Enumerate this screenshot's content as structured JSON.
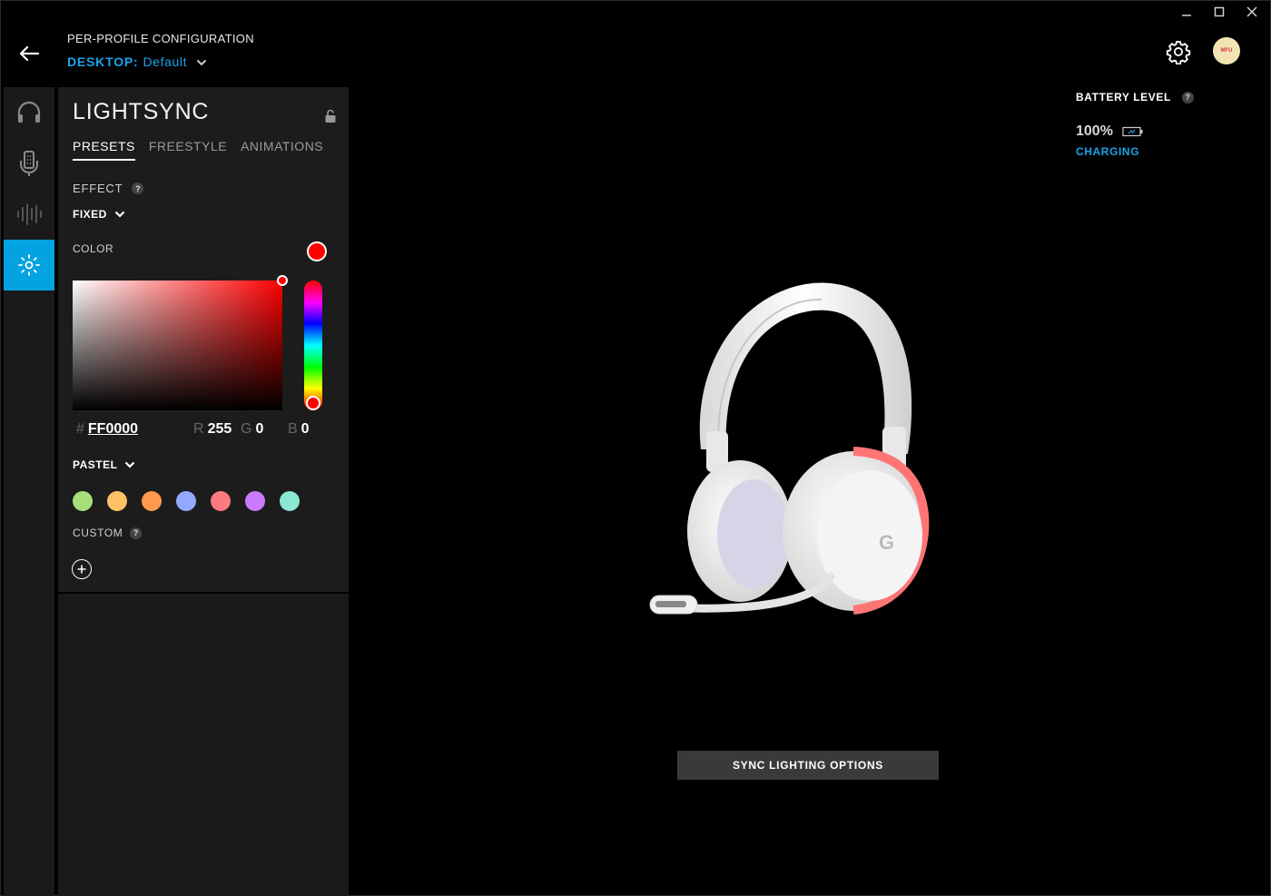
{
  "header": {
    "title": "PER-PROFILE CONFIGURATION",
    "profile_device": "DESKTOP:",
    "profile_name": "Default"
  },
  "user": {
    "avatar_text": "MFU"
  },
  "rail": {
    "items": [
      {
        "icon": "headset-icon",
        "active": false
      },
      {
        "icon": "equalizer-device-icon",
        "active": false
      },
      {
        "icon": "soundwave-icon",
        "active": false
      },
      {
        "icon": "lightsync-icon",
        "active": true
      }
    ]
  },
  "lightsync": {
    "title": "LIGHTSYNC",
    "tabs": [
      {
        "label": "PRESETS",
        "active": true
      },
      {
        "label": "FREESTYLE",
        "active": false
      },
      {
        "label": "ANIMATIONS",
        "active": false
      }
    ],
    "effect_label": "EFFECT",
    "effect_value": "FIXED",
    "color_label": "COLOR",
    "current_color": "#FF0000",
    "hex_prefix": "#",
    "hex": "FF0000",
    "r_label": "R",
    "r": "255",
    "g_label": "G",
    "g": "0",
    "b_label": "B",
    "b": "0",
    "palette_name": "PASTEL",
    "palette": [
      "#a6e07a",
      "#ffc266",
      "#ff9a4d",
      "#94a8ff",
      "#ff7a80",
      "#c97aff",
      "#8ae8d2"
    ],
    "custom_label": "CUSTOM"
  },
  "battery": {
    "label": "BATTERY LEVEL",
    "value": "100%",
    "status": "CHARGING"
  },
  "sync_button": "SYNC LIGHTING OPTIONS",
  "colors": {
    "accent": "#03a2e0",
    "link": "#1aa3e8"
  }
}
